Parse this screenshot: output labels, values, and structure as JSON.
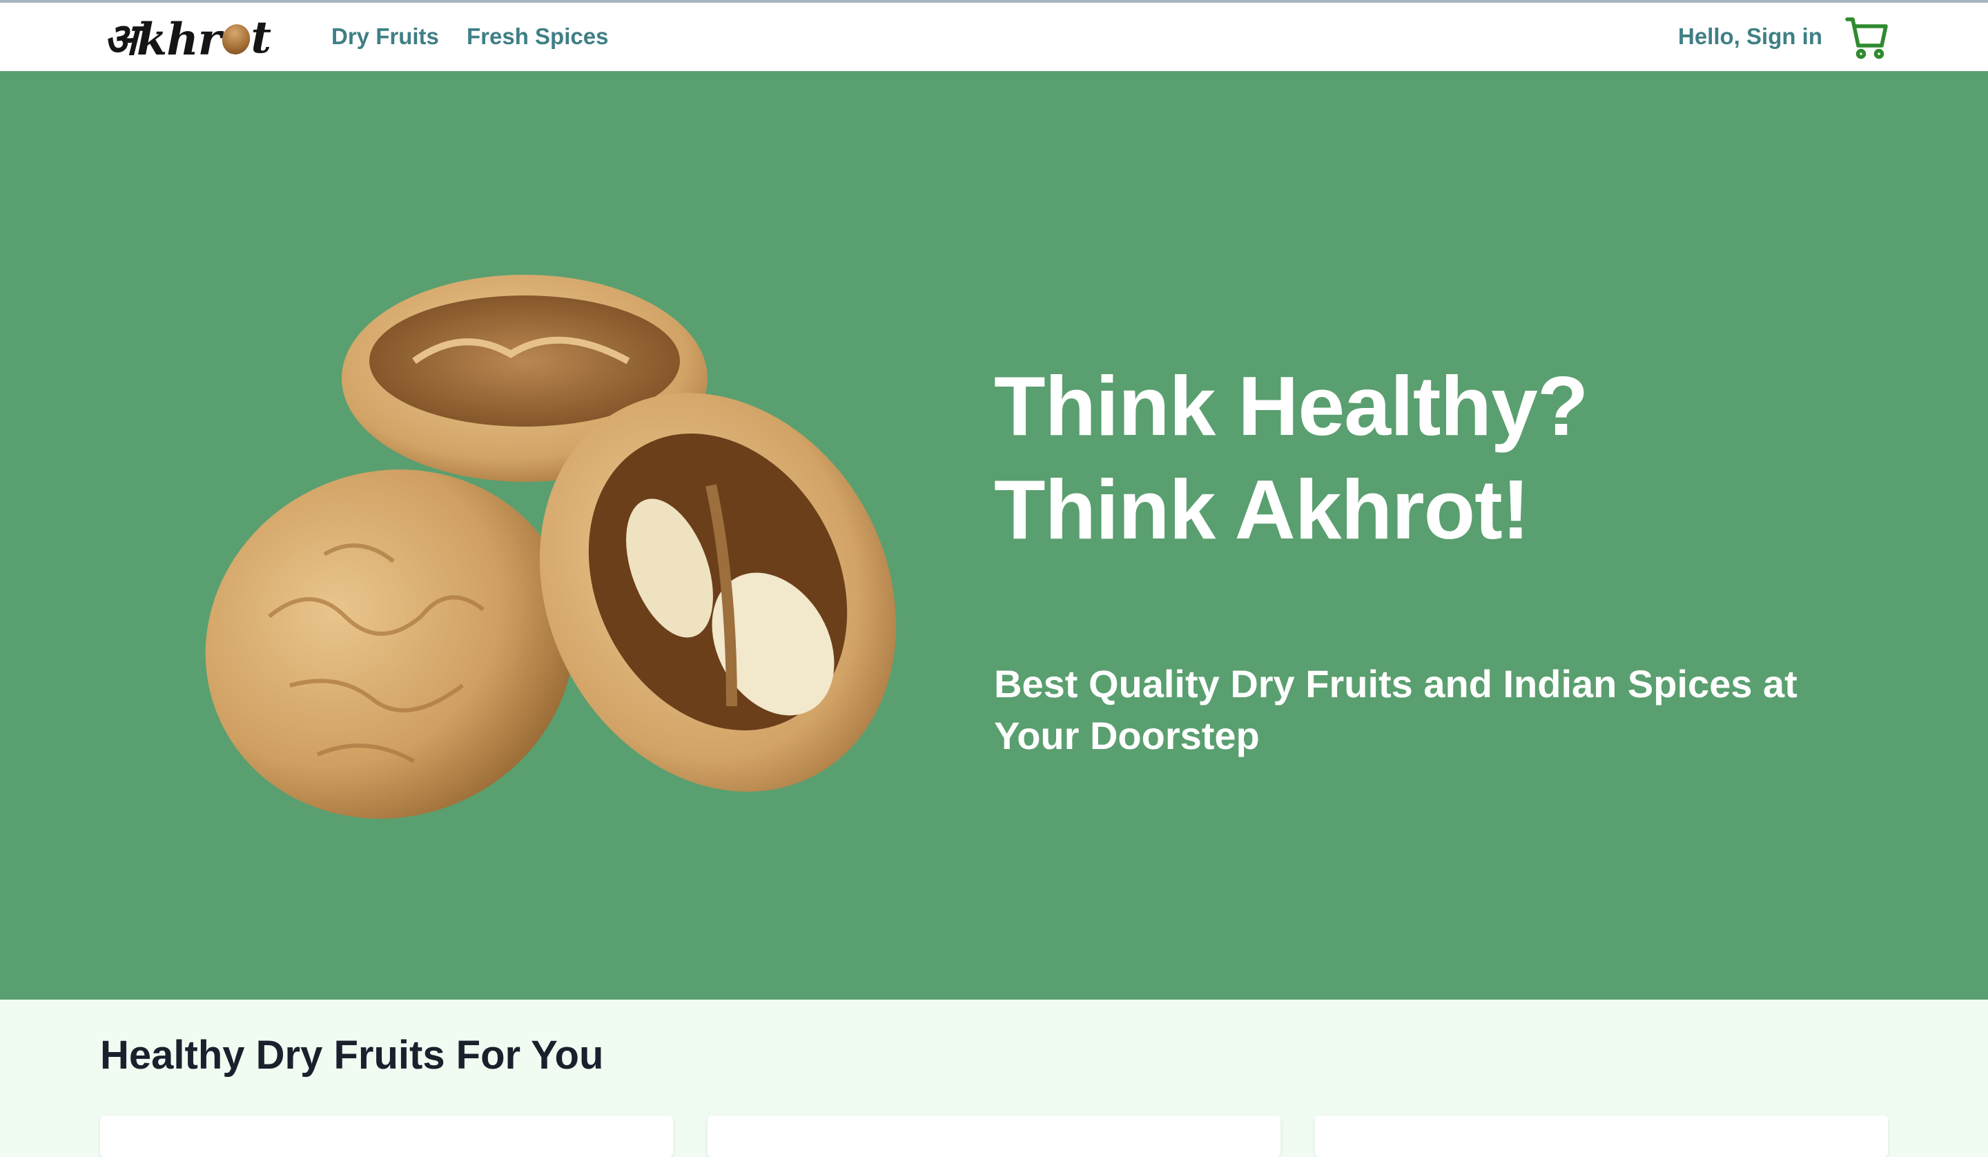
{
  "nav": {
    "logo": {
      "prefix": "अkhr",
      "suffix": "t"
    },
    "links": [
      "Dry Fruits",
      "Fresh Spices"
    ],
    "signin": "Hello, Sign in",
    "cart_icon": "shopping-cart-icon"
  },
  "hero": {
    "title_line1": "Think Healthy?",
    "title_line2": "Think Akhrot!",
    "subtitle": "Best Quality Dry Fruits and Indian Spices at Your Doorstep",
    "image": "walnuts-image"
  },
  "section": {
    "title": "Healthy Dry Fruits For You"
  },
  "colors": {
    "hero_bg": "#5a9f6f",
    "nav_link": "#3f7f85",
    "cart_icon": "#2f8a2f",
    "page_bg": "#f0fbf2"
  }
}
